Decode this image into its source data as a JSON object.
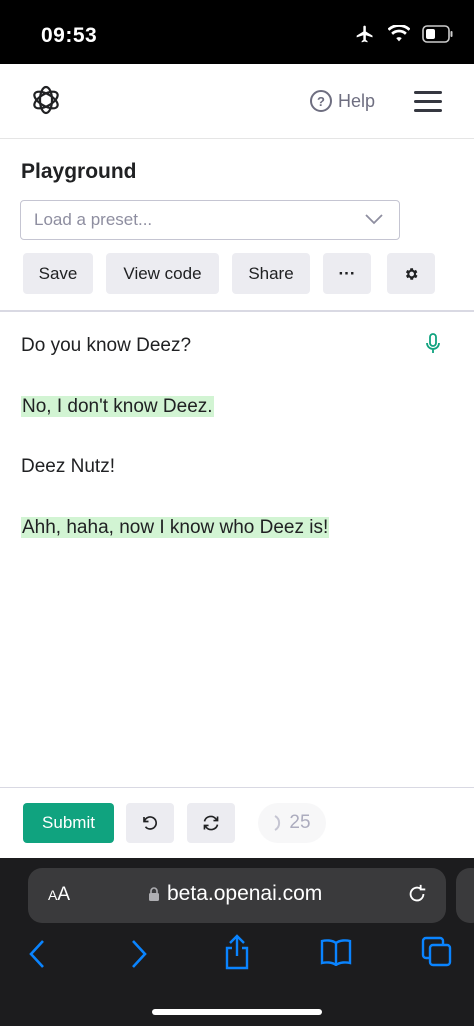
{
  "status_bar": {
    "time": "09:53"
  },
  "header": {
    "help_label": "Help"
  },
  "playground": {
    "title": "Playground",
    "preset_placeholder": "Load a preset...",
    "toolbar": {
      "save": "Save",
      "view_code": "View code",
      "share": "Share",
      "more": "···"
    }
  },
  "editor": {
    "lines": [
      {
        "text": "Do you know Deez?",
        "highlighted": false
      },
      {
        "text": "No, I don't know Deez.",
        "highlighted": true
      },
      {
        "text": "Deez Nutz!",
        "highlighted": false
      },
      {
        "text": "Ahh, haha, now I know who Deez is!",
        "highlighted": true
      }
    ]
  },
  "bottom": {
    "submit": "Submit",
    "token_count": "25"
  },
  "browser": {
    "aa_small": "A",
    "aa_large": "A",
    "url": "beta.openai.com"
  },
  "colors": {
    "accent": "#10a37f",
    "highlight": "#d2f4d3",
    "safari_blue": "#0a84ff"
  }
}
